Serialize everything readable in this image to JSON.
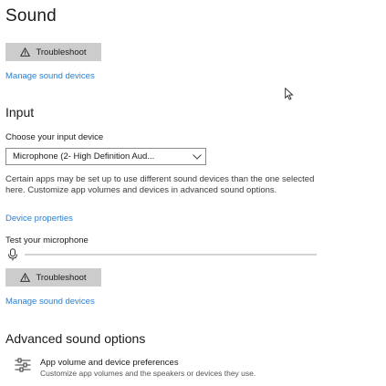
{
  "page": {
    "title": "Sound"
  },
  "output": {
    "troubleshoot_label": "Troubleshoot",
    "manage_link": "Manage sound devices"
  },
  "input": {
    "section_title": "Input",
    "choose_label": "Choose your input device",
    "selected_device": "Microphone (2- High Definition Aud...",
    "description": "Certain apps may be set up to use different sound devices than the one selected here. Customize app volumes and devices in advanced sound options.",
    "device_properties_link": "Device properties",
    "test_label": "Test your microphone",
    "mic_level": 0,
    "troubleshoot_label": "Troubleshoot",
    "manage_link": "Manage sound devices"
  },
  "advanced": {
    "section_title": "Advanced sound options",
    "item_title": "App volume and device preferences",
    "item_subtitle": "Customize app volumes and the speakers or devices they use.",
    "item_icon": "sliders-icon"
  },
  "colors": {
    "link": "#2a7fd4",
    "button": "#cccccc"
  }
}
